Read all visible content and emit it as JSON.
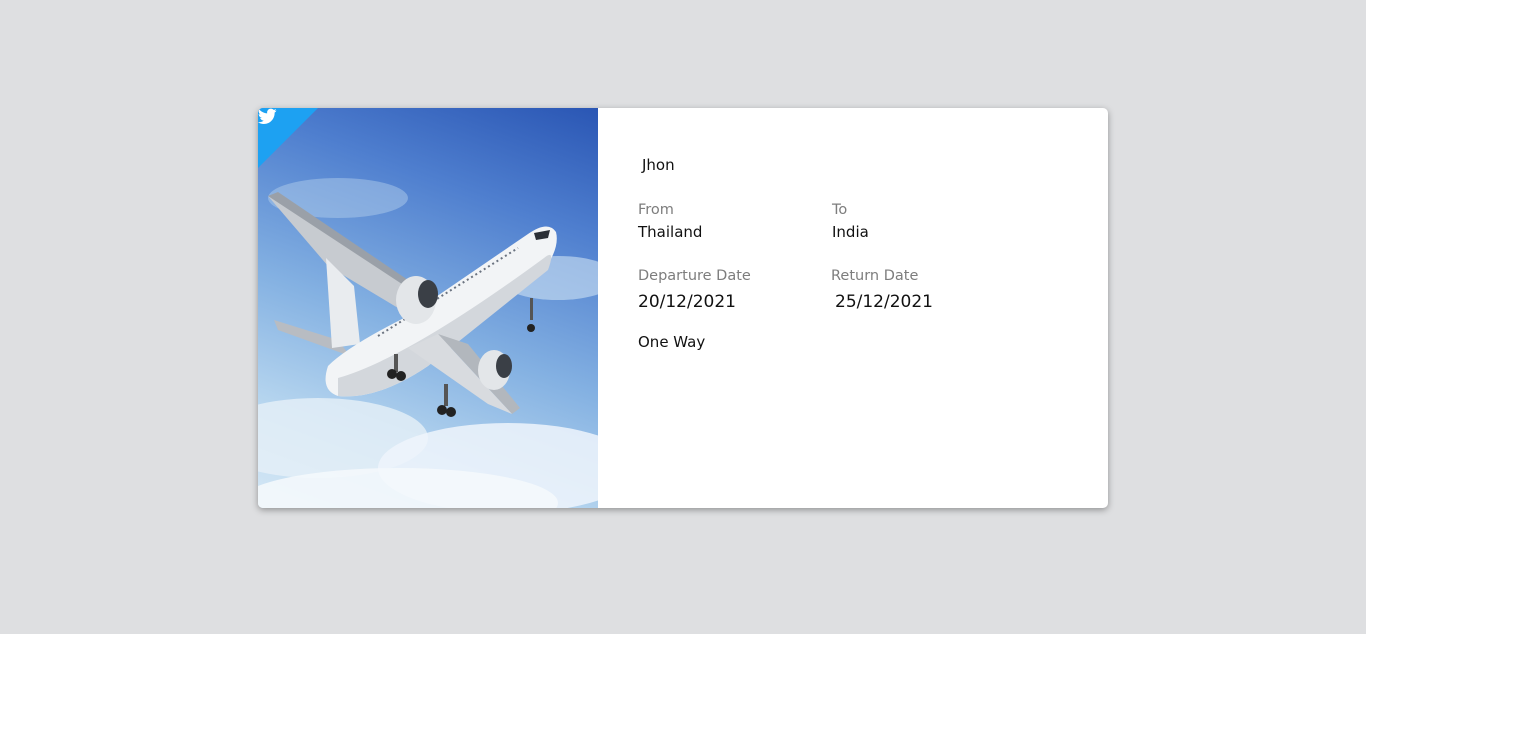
{
  "ticket": {
    "passenger_name": "Jhon",
    "from_label": "From",
    "from_value": "Thailand",
    "to_label": "To",
    "to_value": "India",
    "departure_label": "Departure Date",
    "departure_value": "20/12/2021",
    "return_label": "Return Date",
    "return_value": "25/12/2021",
    "trip_type": "One Way"
  },
  "icons": {
    "corner_badge": "twitter-icon",
    "image": "airplane-photo"
  },
  "colors": {
    "background": "#dedfe1",
    "card": "#ffffff",
    "badge": "#1da1f2",
    "label": "#7d7d7d",
    "value": "#111111"
  }
}
